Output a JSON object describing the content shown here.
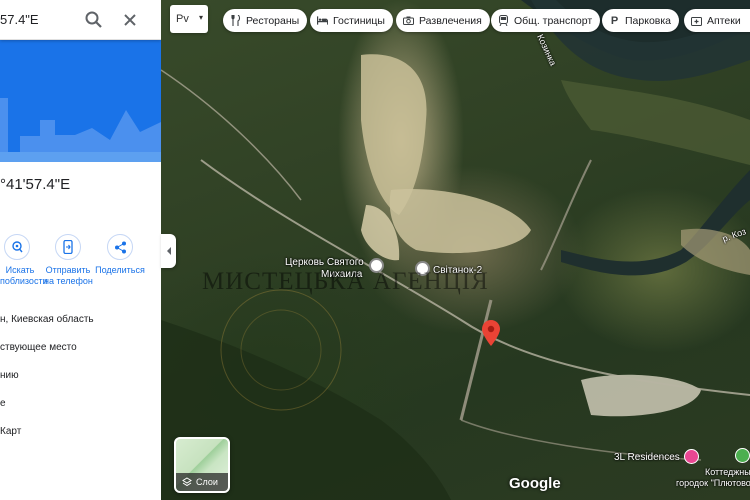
{
  "search": {
    "value": "57.4\"E"
  },
  "place": {
    "coords": "°41'57.4\"E"
  },
  "actions": [
    {
      "label_line1": "Искать",
      "label_line2": "поблизости",
      "icon": "nearby-icon"
    },
    {
      "label_line1": "Отправить",
      "label_line2": "на телефон",
      "icon": "send-to-phone-icon"
    },
    {
      "label_line1": "Поделиться",
      "label_line2": "",
      "icon": "share-icon"
    }
  ],
  "info_rows": [
    {
      "text": "н, Киевская область"
    },
    {
      "text": "ствующее место"
    },
    {
      "text": "нию"
    },
    {
      "text": "е"
    },
    {
      "text": " Карт"
    }
  ],
  "map_type": {
    "label": "Рv",
    "caret": "▾"
  },
  "chips": [
    {
      "label": "Рестораны",
      "icon": "restaurant-icon"
    },
    {
      "label": "Гостиницы",
      "icon": "hotel-icon"
    },
    {
      "label": "Развлечения",
      "icon": "camera-icon"
    },
    {
      "label": "Общ. транспорт",
      "icon": "transit-icon"
    },
    {
      "label": "Парковка",
      "icon": "parking-icon"
    },
    {
      "label": "Аптеки",
      "icon": "pharmacy-icon"
    }
  ],
  "map_labels": {
    "church_line1": "Церковь Святого",
    "church_line2": "Михаила",
    "svitanok": "Світанок-2",
    "river_top": "Козинка",
    "river_right": "р. Коз",
    "residences": "3L Residences",
    "cottage_line1": "Коттеджный",
    "cottage_line2": "городок \"Плютово\""
  },
  "watermark": "МИСТЕЦЬКА АГЕНЦІЯ",
  "google_logo": "Google",
  "layers_label": "Слои",
  "colors": {
    "accent": "#1a73e8",
    "pin": "#ea4335",
    "poi_pink": "#e94792"
  }
}
